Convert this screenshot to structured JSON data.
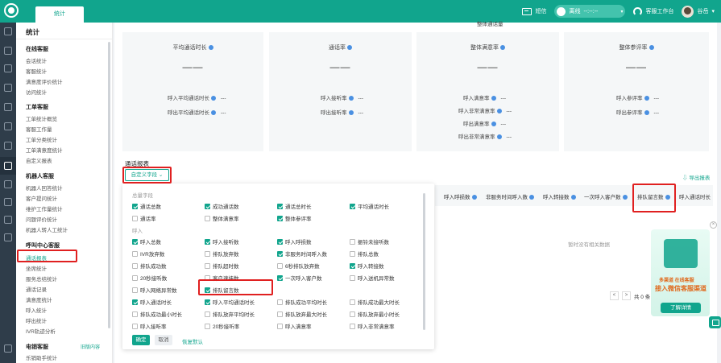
{
  "topbar": {
    "tab": "统计",
    "sms": "短信",
    "status": "离线",
    "status_time": "--:--:--",
    "workbench": "客服工作台",
    "user": "谷岳"
  },
  "sidebar": {
    "title": "统计",
    "groups": {
      "online": {
        "label": "在线客服",
        "items": [
          "会话统计",
          "客服统计",
          "满意度评价统计",
          "访问统计"
        ]
      },
      "ticket": {
        "label": "工单客服",
        "items": [
          "工单统计概览",
          "客服工作量",
          "工单分类统计",
          "工单满意度统计",
          "自定义报表"
        ]
      },
      "robot": {
        "label": "机器人客服",
        "items": [
          "机器人回答统计",
          "客户提问统计",
          "维护工作量统计",
          "问题评价统计",
          "机器人转人工统计"
        ]
      },
      "callcenter": {
        "label": "呼叫中心客服",
        "items": [
          "通话报表",
          "坐席统计",
          "服务总结统计",
          "通话记录",
          "满意度统计",
          "呼入统计",
          "呼出统计",
          "IVR轨迹分析"
        ]
      },
      "sales": {
        "label": "电销客服",
        "extra": "旧版内容",
        "items": [
          "乐销助手统计"
        ]
      }
    }
  },
  "metrics": {
    "cut_label": "整体通话量",
    "cards": [
      {
        "title": "平均通话时长",
        "value": "——",
        "subs": [
          {
            "label": "呼入平均通话时长",
            "value": "---"
          },
          {
            "label": "呼出平均通话时长",
            "value": "---"
          }
        ]
      },
      {
        "title": "通话率",
        "value": "——",
        "subs": [
          {
            "label": "呼入接听率",
            "value": "---"
          },
          {
            "label": "呼出接听率",
            "value": "---"
          }
        ]
      },
      {
        "title": "整体满意率",
        "value": "——",
        "subs": [
          {
            "label": "呼入满意率",
            "value": "---"
          },
          {
            "label": "呼入非常满意率",
            "value": "---"
          },
          {
            "label": "呼出满意率",
            "value": "---"
          },
          {
            "label": "呼出非常满意率",
            "value": "---"
          }
        ]
      },
      {
        "title": "整体参评率",
        "value": "——",
        "subs": [
          {
            "label": "呼入参评率",
            "value": "---"
          },
          {
            "label": "呼出参评率",
            "value": "---"
          }
        ]
      }
    ]
  },
  "report": {
    "title": "通话报表",
    "custom_field_btn": "自定义字段",
    "export": "导出报表",
    "columns": [
      "呼入呼损数",
      "非服务时间呼入数",
      "呼入转接数",
      "一次呼入客户数",
      "排队留言数",
      "呼入通话时长"
    ],
    "empty": "暂时没有相关数据",
    "pager": {
      "prev": "<",
      "next": ">",
      "total": "共 0 条"
    }
  },
  "panel": {
    "group_total": "总量字段",
    "group_in": "呼入",
    "total_fields": [
      {
        "label": "通话总数",
        "checked": true
      },
      {
        "label": "成功通话数",
        "checked": true
      },
      {
        "label": "通话总时长",
        "checked": true
      },
      {
        "label": "平均通话时长",
        "checked": true
      },
      {
        "label": "通话率",
        "checked": false
      },
      {
        "label": "整体满意率",
        "checked": false
      },
      {
        "label": "整体参评率",
        "checked": true
      }
    ],
    "in_fields": [
      {
        "label": "呼入总数",
        "checked": true
      },
      {
        "label": "呼入接听数",
        "checked": true
      },
      {
        "label": "呼入呼损数",
        "checked": true
      },
      {
        "label": "振铃未接听数",
        "checked": false
      },
      {
        "label": "IVR放弃数",
        "checked": false
      },
      {
        "label": "排队放弃数",
        "checked": false
      },
      {
        "label": "非服务时间呼入数",
        "checked": true
      },
      {
        "label": "排队总数",
        "checked": false
      },
      {
        "label": "排队成功数",
        "checked": false
      },
      {
        "label": "排队超时数",
        "checked": false
      },
      {
        "label": "6秒排队放弃数",
        "checked": false
      },
      {
        "label": "呼入转接数",
        "checked": true
      },
      {
        "label": "20秒接听数",
        "checked": false
      },
      {
        "label": "客户速挂数",
        "checked": false
      },
      {
        "label": "一次呼入客户数",
        "checked": true
      },
      {
        "label": "呼入送机异常数",
        "checked": false
      },
      {
        "label": "呼入网络异常数",
        "checked": false
      },
      {
        "label": "排队留言数",
        "checked": true
      },
      {
        "label": "呼入通话时长",
        "checked": true
      },
      {
        "label": "呼入平均通话时长",
        "checked": true
      },
      {
        "label": "排队成功平均时长",
        "checked": false
      },
      {
        "label": "排队成功最大时长",
        "checked": false
      },
      {
        "label": "排队成功最小时长",
        "checked": false
      },
      {
        "label": "排队放弃平均时长",
        "checked": false
      },
      {
        "label": "排队放弃最大时长",
        "checked": false
      },
      {
        "label": "排队放弃最小时长",
        "checked": false
      },
      {
        "label": "呼入接听率",
        "checked": false
      },
      {
        "label": "20秒接听率",
        "checked": false
      },
      {
        "label": "呼入满意率",
        "checked": false
      },
      {
        "label": "呼入非常满意率",
        "checked": false
      }
    ],
    "ok": "确定",
    "cancel": "取消",
    "restore": "恢复默认"
  },
  "promo": {
    "tag": "多渠道 在线客服",
    "title": "接入微信客服渠道",
    "button": "了解详情",
    "close": "×"
  }
}
